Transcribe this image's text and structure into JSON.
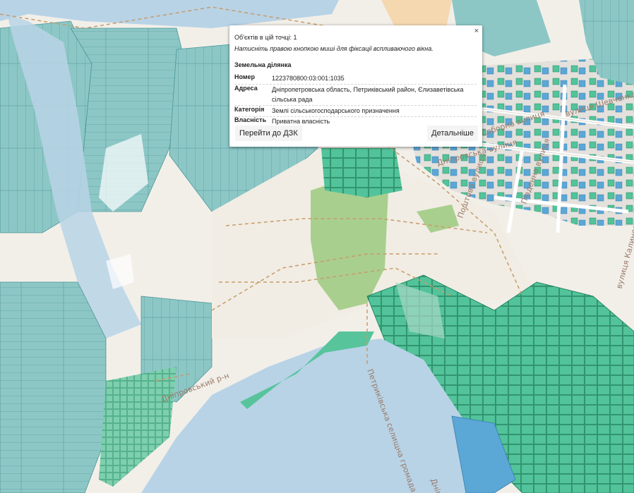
{
  "map": {
    "labels": {
      "street_sobornaya": "Соборна вулиця",
      "street_shevchenka": "вулиця Шевченка",
      "street_dnipro": "Дніпровська вулиця",
      "street_poshtova": "Поштова вулиця",
      "street_pivdenna": "Південна вулиця",
      "street_kalynova": "вулиця Калинова",
      "street_dniprovskyi": "Дніпровський р-н",
      "lake_label": "Петриківська селищна громада",
      "lake_label_short": "Дніп"
    },
    "colors": {
      "parcel_agri": "#8cc7c6",
      "parcel_dense": "#53c49a",
      "water": "#b8d3e6",
      "land": "#f2efe9",
      "forest": "#a9cf8e"
    }
  },
  "popup": {
    "close_label": "×",
    "objects_count": "Об'єктів в цій точці: 1",
    "hint": "Натисніть правою кнопкою миші для фіксації вспливаючого вікна.",
    "section_title": "Земельна ділянка",
    "rows": [
      {
        "label": "Номер",
        "value": "1223780800:03:001:1035"
      },
      {
        "label": "Адреса",
        "value": "Дніпропетровська область, Петриківський район, Єлизаветівська сільська рада"
      },
      {
        "label": "Категорія",
        "value": "Землі сільськогосподарського призначення"
      },
      {
        "label": "Власність",
        "value": "Приватна власність"
      }
    ],
    "goto_button": "Перейти до ДЗК",
    "details_button": "Детальніше"
  }
}
